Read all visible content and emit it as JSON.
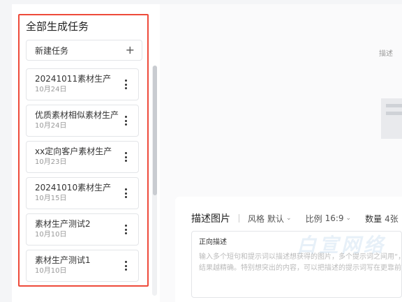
{
  "sidebar": {
    "title": "全部生成任务",
    "new_task_label": "新建任务",
    "tasks": [
      {
        "name": "20241011素材生产",
        "date": "10月24日"
      },
      {
        "name": "优质素材相似素材生产",
        "date": "10月24日"
      },
      {
        "name": "xx定向客户素材生产",
        "date": "10月23日"
      },
      {
        "name": "20241010素材生产",
        "date": "10月15日"
      },
      {
        "name": "素材生产测试2",
        "date": "10月10日"
      },
      {
        "name": "素材生产测试1",
        "date": "10月10日"
      }
    ]
  },
  "main": {
    "hint": "描述",
    "prompt": {
      "title": "描述图片",
      "style_label": "风格",
      "style_value": "默认",
      "ratio_label": "比例",
      "ratio_value": "16:9",
      "qty_label": "数量",
      "qty_value": "4张",
      "box_label": "正向描述",
      "placeholder_line1": "输入多个短句和提示词以描述想获得的图片，多个提示词之间用“，”",
      "placeholder_line2": "结果越精确。特别想突出的内容，可以把描述的提示词写在更靠前的位置"
    },
    "watermark": "白宣网络"
  },
  "colors": {
    "highlight": "#ee4a3a"
  }
}
